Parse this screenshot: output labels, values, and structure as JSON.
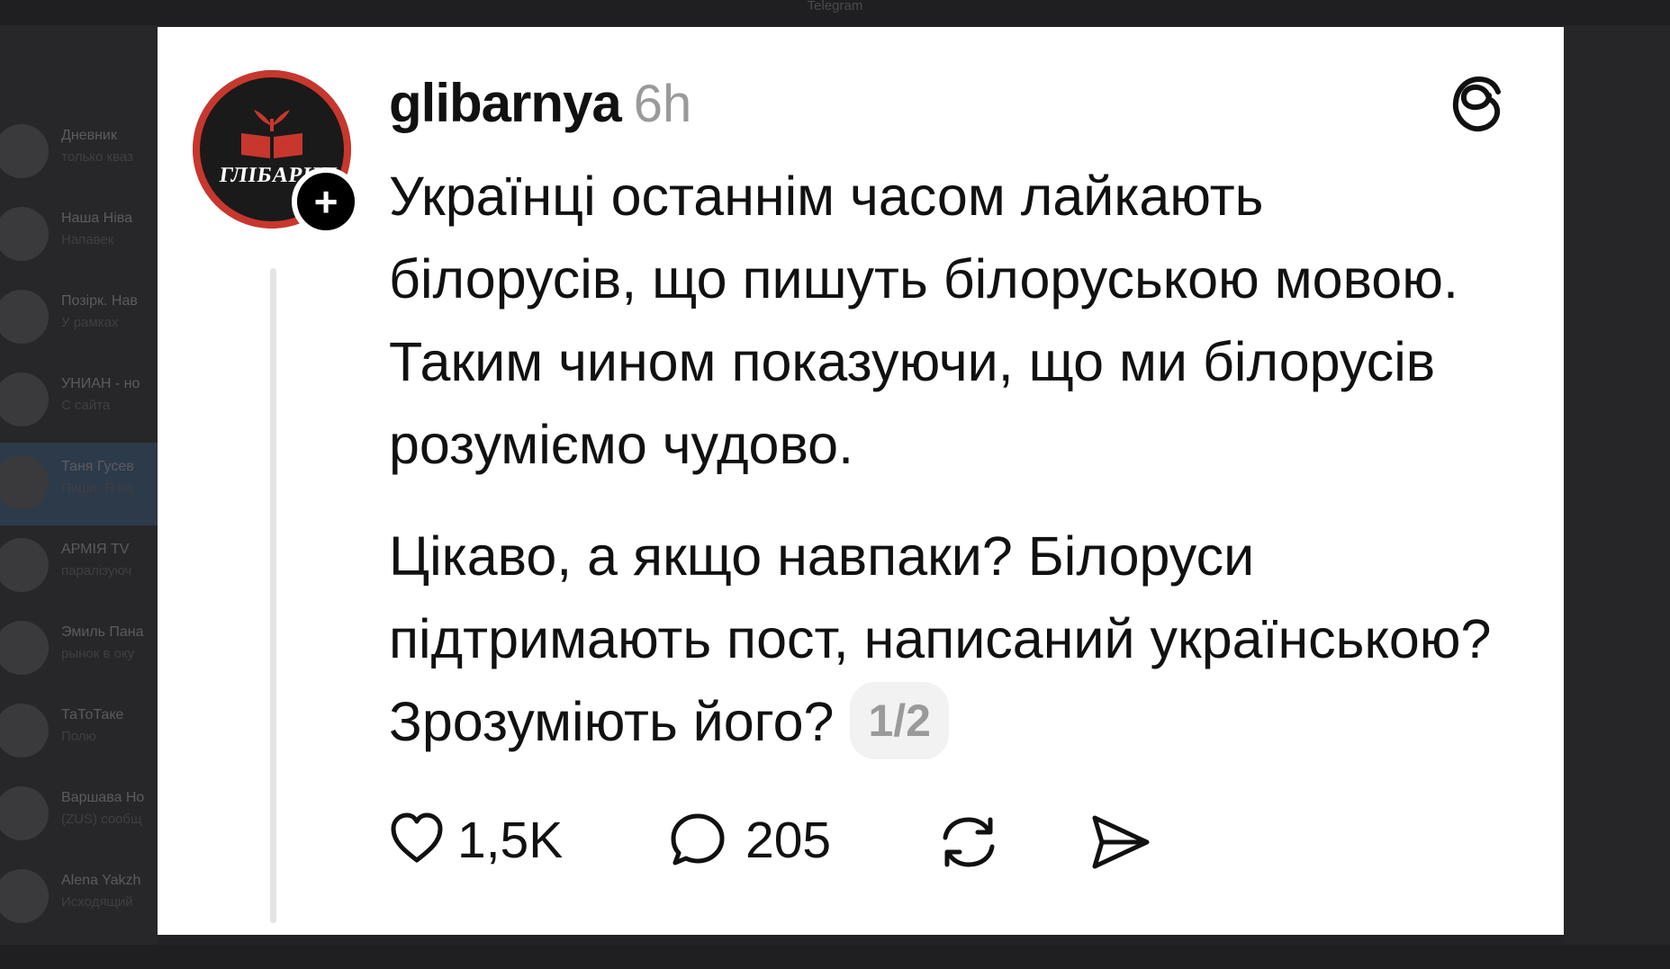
{
  "window": {
    "title": "Telegram"
  },
  "sidebar": {
    "chats": [
      {
        "title": "Дневник",
        "preview": "только кваз"
      },
      {
        "title": "Наша Ніва",
        "preview": "Напавек"
      },
      {
        "title": "Позірк. Нав",
        "preview": "У рамках"
      },
      {
        "title": "УНИАН - но",
        "preview": "С сайта"
      },
      {
        "title": "Таня Гусев",
        "preview": "Пиши. Я на"
      },
      {
        "title": "АРМІЯ TV",
        "preview": "паралізуюч"
      },
      {
        "title": "Эмиль Пана",
        "preview": "рынок в оку"
      },
      {
        "title": "ТаТоТаке",
        "preview": "Полю"
      },
      {
        "title": "Варшава Но",
        "preview": "(ZUS) сообщ"
      },
      {
        "title": "Alena Yakzh",
        "preview": "Исходящий"
      }
    ]
  },
  "post": {
    "username": "glibarnya",
    "time": "6h",
    "avatar_label": "ГЛІБАРНЯ",
    "paragraphs": [
      "Українці останнім часом лайкають білорусів, що пишуть білоруською мовою. Таким чином показуючи, що ми білорусів розуміємо чудово.",
      "Цікаво, а якщо навпаки? Білоруси підтримають пост, написаний українською? Зрозуміють його?"
    ],
    "page_indicator": "1/2",
    "likes": "1,5K",
    "comments": "205"
  },
  "colors": {
    "card_background": "#ffffff",
    "text": "#111111",
    "muted": "#9a9a9a",
    "avatar_ring": "#c8372d",
    "avatar_fill": "#1a1a1a"
  },
  "icons": [
    "heart-icon",
    "comment-icon",
    "repost-icon",
    "share-icon",
    "threads-logo-icon",
    "plus-icon"
  ]
}
